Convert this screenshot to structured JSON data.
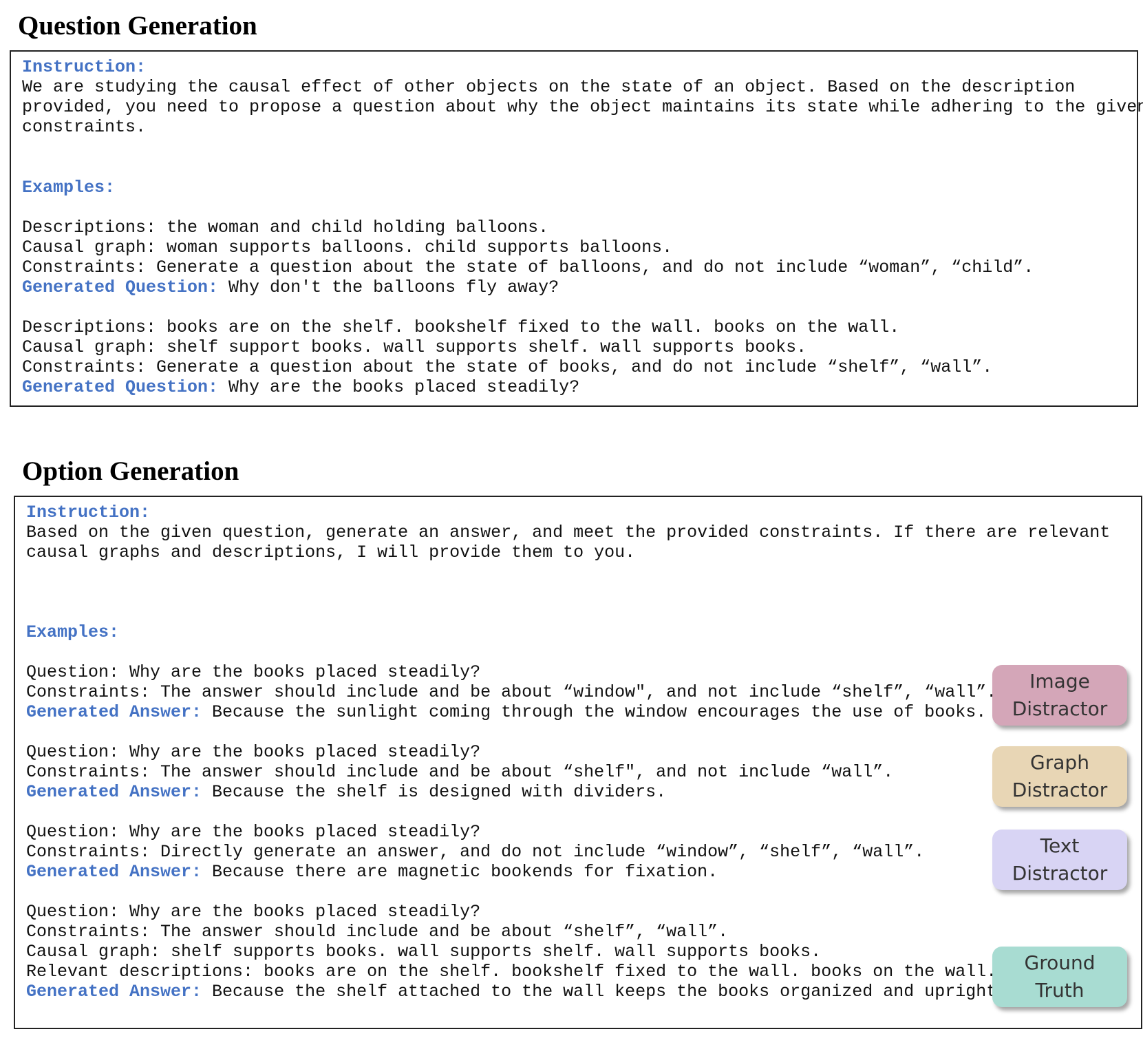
{
  "question_generation": {
    "title": "Question Generation",
    "instruction_label": "Instruction:",
    "instruction_lines": [
      "We are studying the causal effect of other objects on the state of an object. Based on the description",
      "provided, you need to propose a question about why the object maintains its state while adhering to the given",
      "constraints."
    ],
    "examples_label": "Examples:",
    "examples": [
      {
        "descriptions": "Descriptions: the woman and child holding balloons.",
        "causal_graph": "Causal graph: woman supports balloons. child supports balloons.",
        "constraints": "Constraints: Generate a question about the state of balloons, and do not include “woman”, “child”.",
        "generated_label": "Generated Question:",
        "generated_text": " Why don't the balloons fly away?"
      },
      {
        "descriptions": "Descriptions: books are on the shelf. bookshelf fixed to the wall. books on the wall.",
        "causal_graph": "Causal graph: shelf support books. wall supports shelf. wall supports books.",
        "constraints": "Constraints: Generate a question about the state of books, and do not include “shelf”, “wall”.",
        "generated_label": "Generated Question:",
        "generated_text": " Why are the books placed steadily?"
      }
    ]
  },
  "option_generation": {
    "title": "Option Generation",
    "instruction_label": "Instruction:",
    "instruction_lines": [
      "Based on the given question, generate an answer, and meet the provided constraints. If there are relevant",
      "causal graphs and descriptions, I will provide them to you."
    ],
    "examples_label": "Examples:",
    "examples": [
      {
        "question": "Question: Why are the books placed steadily?",
        "constraints": "Constraints: The answer should include and be about “window\", and not include “shelf”, “wall”.",
        "generated_label": "Generated Answer:",
        "generated_text": " Because the sunlight coming through the window encourages the use of books.",
        "tag_line1": "Image",
        "tag_line2": "Distractor",
        "tag_color": "#d4a6b8"
      },
      {
        "question": "Question: Why are the books placed steadily?",
        "constraints": "Constraints: The answer should include and be about “shelf\", and not include “wall”.",
        "generated_label": "Generated Answer:",
        "generated_text": " Because the shelf is designed with dividers.",
        "tag_line1": "Graph",
        "tag_line2": "Distractor",
        "tag_color": "#e8d6b5"
      },
      {
        "question": "Question: Why are the books placed steadily?",
        "constraints": "Constraints: Directly generate an answer, and do not include “window”, “shelf”, “wall”.",
        "generated_label": "Generated Answer:",
        "generated_text": " Because there are magnetic bookends for fixation.",
        "tag_line1": "Text",
        "tag_line2": "Distractor",
        "tag_color": "#d8d4f4"
      },
      {
        "question": "Question: Why are the books placed steadily?",
        "constraints": "Constraints: The answer should include and be about “shelf”, “wall”.",
        "causal_graph": "Causal graph: shelf supports books. wall supports shelf. wall supports books.",
        "relevant_descriptions": "Relevant descriptions: books are on the shelf. bookshelf fixed to the wall. books on the wall.",
        "generated_label": "Generated Answer:",
        "generated_text": " Because the shelf attached to the wall keeps the books organized and upright.",
        "tag_line1": "Ground",
        "tag_line2": "Truth",
        "tag_color": "#a8dcd2"
      }
    ]
  }
}
